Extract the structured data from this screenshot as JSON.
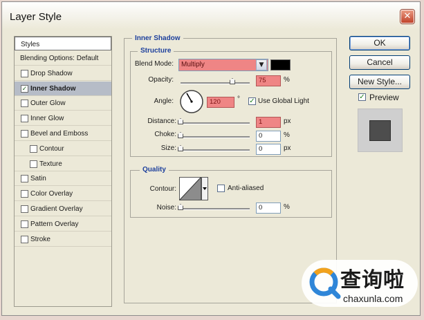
{
  "window": {
    "title": "Layer Style",
    "close_glyph": "✕"
  },
  "styles_list": {
    "header": "Styles",
    "items": [
      {
        "label": "Blending Options: Default",
        "has_checkbox": false,
        "checked": false,
        "selected": false,
        "indent": false
      },
      {
        "label": "Drop Shadow",
        "has_checkbox": true,
        "checked": false,
        "selected": false,
        "indent": false
      },
      {
        "label": "Inner Shadow",
        "has_checkbox": true,
        "checked": true,
        "selected": true,
        "indent": false
      },
      {
        "label": "Outer Glow",
        "has_checkbox": true,
        "checked": false,
        "selected": false,
        "indent": false
      },
      {
        "label": "Inner Glow",
        "has_checkbox": true,
        "checked": false,
        "selected": false,
        "indent": false
      },
      {
        "label": "Bevel and Emboss",
        "has_checkbox": true,
        "checked": false,
        "selected": false,
        "indent": false
      },
      {
        "label": "Contour",
        "has_checkbox": true,
        "checked": false,
        "selected": false,
        "indent": true
      },
      {
        "label": "Texture",
        "has_checkbox": true,
        "checked": false,
        "selected": false,
        "indent": true
      },
      {
        "label": "Satin",
        "has_checkbox": true,
        "checked": false,
        "selected": false,
        "indent": false
      },
      {
        "label": "Color Overlay",
        "has_checkbox": true,
        "checked": false,
        "selected": false,
        "indent": false
      },
      {
        "label": "Gradient Overlay",
        "has_checkbox": true,
        "checked": false,
        "selected": false,
        "indent": false
      },
      {
        "label": "Pattern Overlay",
        "has_checkbox": true,
        "checked": false,
        "selected": false,
        "indent": false
      },
      {
        "label": "Stroke",
        "has_checkbox": true,
        "checked": false,
        "selected": false,
        "indent": false
      }
    ]
  },
  "inner_shadow": {
    "title": "Inner Shadow",
    "structure": {
      "title": "Structure",
      "blend_mode": {
        "label": "Blend Mode:",
        "value": "Multiply",
        "color": "#000000"
      },
      "opacity": {
        "label": "Opacity:",
        "value": "75",
        "unit": "%",
        "level": 0.75
      },
      "angle": {
        "label": "Angle:",
        "value": "120",
        "unit": "°",
        "degrees": 120,
        "use_global_light": "Use Global Light",
        "global_checked": true
      },
      "distance": {
        "label": "Distance:",
        "value": "1",
        "unit": "px",
        "level": 0
      },
      "choke": {
        "label": "Choke:",
        "value": "0",
        "unit": "%",
        "level": 0
      },
      "size": {
        "label": "Size:",
        "value": "0",
        "unit": "px",
        "level": 0
      }
    },
    "quality": {
      "title": "Quality",
      "contour": {
        "label": "Contour:",
        "anti_aliased": "Anti-aliased",
        "anti_aliased_checked": false
      },
      "noise": {
        "label": "Noise:",
        "value": "0",
        "unit": "%",
        "level": 0
      }
    }
  },
  "buttons": {
    "ok": "OK",
    "cancel": "Cancel",
    "new_style": "New Style..."
  },
  "preview": {
    "label": "Preview",
    "checked": true
  },
  "watermark": {
    "brand": "查询啦",
    "url": "chaxunla.com"
  },
  "icons": {
    "check": "✓",
    "dropdown": "▼",
    "close": "close-icon",
    "angle": "angle-dial-icon",
    "contour": "contour-curve-icon",
    "logo": "search-logo-icon"
  }
}
